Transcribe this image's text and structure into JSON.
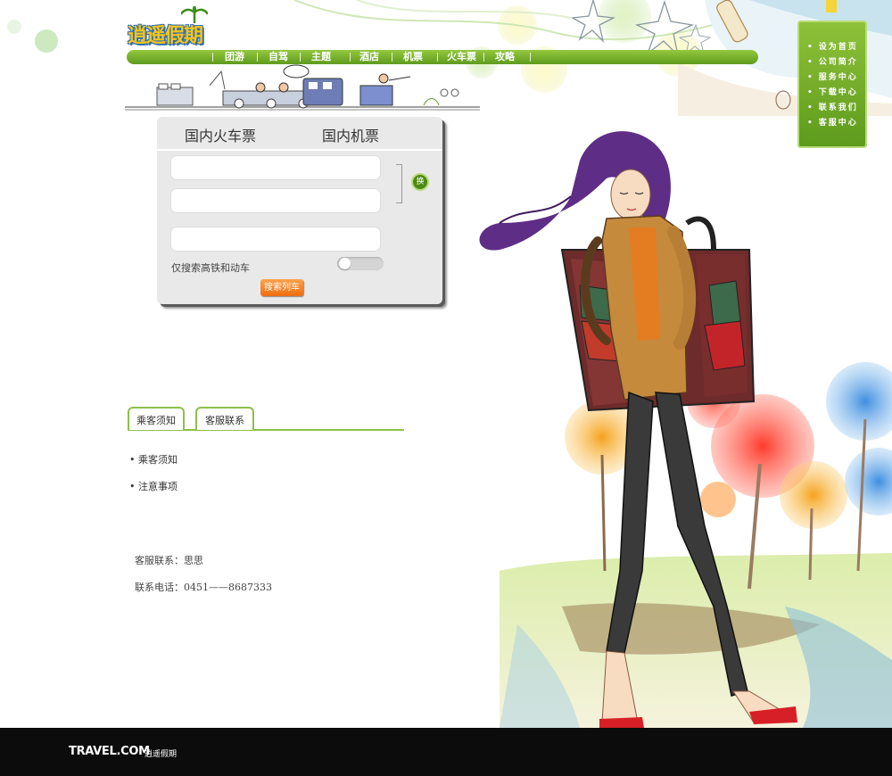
{
  "header": {
    "logo_text": "逍遥假期",
    "nav": [
      "团游",
      "自驾",
      "主题",
      "酒店",
      "机票",
      "火车票",
      "攻略"
    ]
  },
  "right_menu": {
    "items": [
      "设为首页",
      "公司简介",
      "服务中心",
      "下载中心",
      "联系我们",
      "客服中心"
    ]
  },
  "search_panel": {
    "tabs": [
      "国内火车票",
      "国内机票"
    ],
    "from_value": "",
    "to_value": "",
    "date_value": "",
    "swap_label": "换",
    "hsr_only_label": "仅搜索高铁和动车",
    "hsr_only_enabled": false,
    "search_button": "搜索列车"
  },
  "info": {
    "tabs": [
      "乘客须知",
      "客服联系"
    ],
    "links": [
      "乘客须知",
      "注意事项"
    ],
    "contact_name_line": "客服联系：思思",
    "contact_phone_line": "联系电话：0451——8687333"
  },
  "footer": {
    "brand": "TRAVEL.COM",
    "sub": "逍遥假期"
  },
  "colors": {
    "accent_green": "#6aa524",
    "button_orange": "#f47f1f",
    "footer_bg": "#0c0c0c"
  }
}
